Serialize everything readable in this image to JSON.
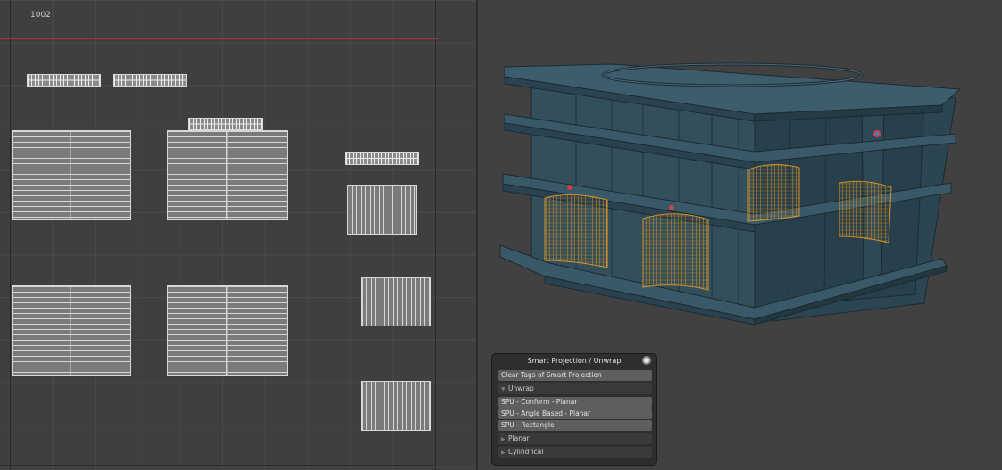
{
  "uv_editor": {
    "tile_label": "1002"
  },
  "panel": {
    "title": "Smart Projection / Unwrap",
    "clear_tags_label": "Clear Tags of Smart Projection",
    "sections": {
      "unwrap": {
        "label": "Unwrap",
        "expanded": true,
        "items": [
          "SPU - Conform - Planar",
          "SPU - Angle Based - Planar",
          "SPU - Rectangle"
        ]
      },
      "planar": {
        "label": "Planar",
        "expanded": false
      },
      "cylindrical": {
        "label": "Cylindrical",
        "expanded": false
      }
    },
    "icons": {
      "expanded": "triangle-down-icon",
      "collapsed": "triangle-right-icon",
      "close": "circle-close-icon"
    }
  },
  "colors": {
    "mesh_face": "#2f4a57",
    "mesh_face_light": "#3f5f6e",
    "wire": "#1c2b33",
    "selection": "#f0a020",
    "uv_line": "#d6d6d6",
    "uv_tile_border": "#b03030"
  }
}
